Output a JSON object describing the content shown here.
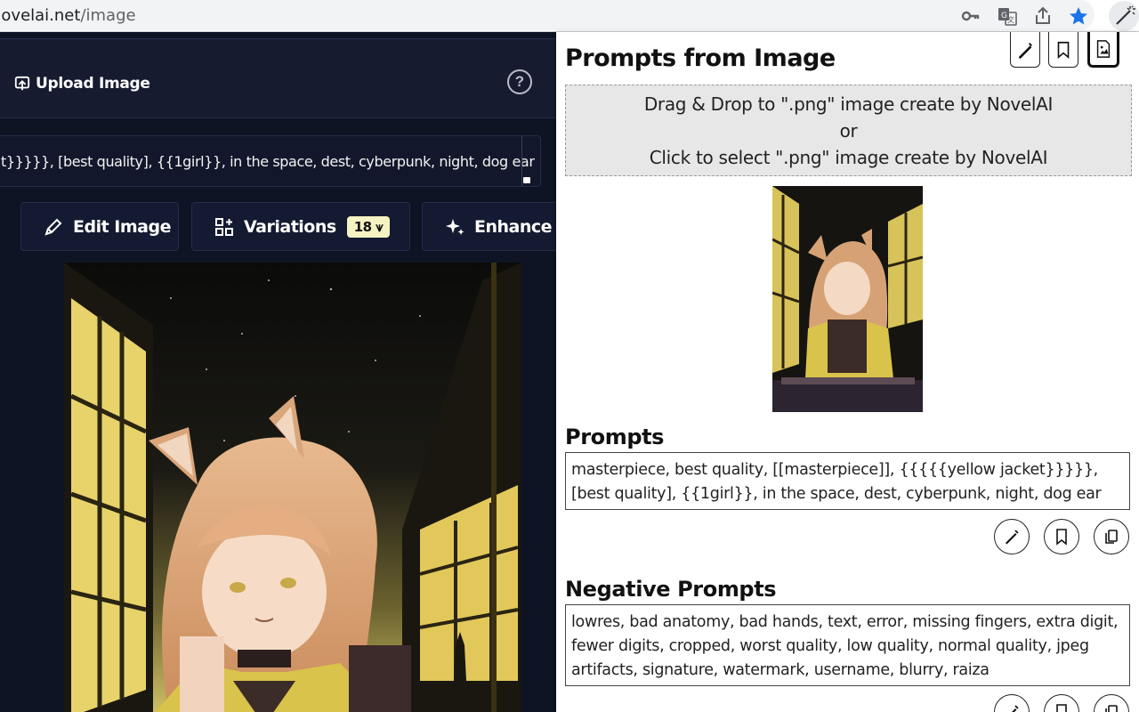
{
  "browser": {
    "url_host": "novelai.net",
    "url_path": "/image",
    "icons": [
      "key-icon",
      "translate-icon",
      "share-icon",
      "bookmark-star-icon",
      "extension-wand-icon"
    ]
  },
  "app": {
    "upload_label": "Upload Image",
    "help_label": "?",
    "prompt_text": "t}}}}}, [best quality], {{1girl}}, in the space, dest, cyberpunk, night, dog ear",
    "tools": {
      "edit_label": "Edit Image",
      "variations_label": "Variations",
      "variations_cost": "18",
      "enhance_label": "Enhance"
    }
  },
  "panel": {
    "title": "Prompts from Image",
    "dropzone": {
      "line1": "Drag & Drop to \".png\" image create by NovelAI",
      "line2": "or",
      "line3": "Click to select \".png\" image create by NovelAI"
    },
    "prompts_title": "Prompts",
    "prompts_text": "masterpiece, best quality, [[masterpiece]], {{{{{yellow jacket}}}}}, [best quality], {{1girl}}, in the space, dest, cyberpunk, night, dog ear",
    "negative_title": "Negative Prompts",
    "negative_text": "lowres, bad anatomy, bad hands, text, error, missing fingers, extra digit, fewer digits, cropped, worst quality, low quality, normal quality, jpeg artifacts, signature, watermark, username, blurry, raiza"
  },
  "colors": {
    "app_bg": "#0e1424",
    "anlas_badge": "#f5f3c2",
    "star_blue": "#1a73e8"
  }
}
